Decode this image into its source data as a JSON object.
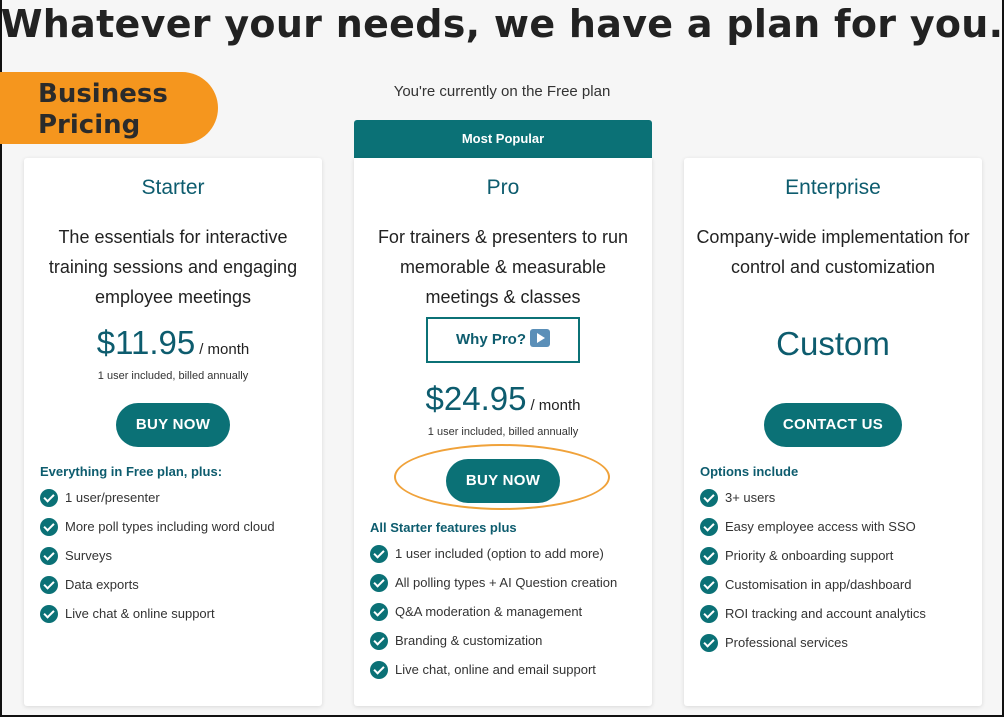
{
  "page": {
    "headline": "Whatever your needs, we have a plan for you.",
    "current_plan": "You're currently on the Free plan",
    "badge": {
      "line1": "Business",
      "line2": "Pricing"
    }
  },
  "colors": {
    "accent": "#0b7176",
    "badge": "#f5961e",
    "highlight": "#f0a23a"
  },
  "plans": [
    {
      "name": "Starter",
      "description": "The essentials for interactive training sessions and engaging employee meetings",
      "price": "$11.95",
      "per": "/ month",
      "billing": "1 user included, billed annually",
      "button": "BUY NOW",
      "features_heading": "Everything in Free plan, plus:",
      "features": [
        "1 user/presenter",
        "More poll types including word cloud",
        "Surveys",
        "Data exports",
        "Live chat & online support"
      ]
    },
    {
      "name": "Pro",
      "ribbon": "Most Popular",
      "description": "For trainers & presenters to run memorable & measurable meetings & classes",
      "why_button": "Why Pro?",
      "price": "$24.95",
      "per": "/ month",
      "billing": "1 user included, billed annually",
      "button": "BUY NOW",
      "features_heading": "All Starter features plus",
      "features": [
        "1 user included (option to add more)",
        "All polling types + AI Question creation",
        "Q&A moderation & management",
        "Branding & customization",
        "Live chat, online and email support"
      ]
    },
    {
      "name": "Enterprise",
      "description": "Company-wide implementation for control and customization",
      "price": "Custom",
      "button": "CONTACT US",
      "features_heading": "Options include",
      "features": [
        "3+ users",
        "Easy employee access with SSO",
        "Priority & onboarding support",
        "Customisation in app/dashboard",
        "ROI tracking and account analytics",
        "Professional services"
      ]
    }
  ]
}
